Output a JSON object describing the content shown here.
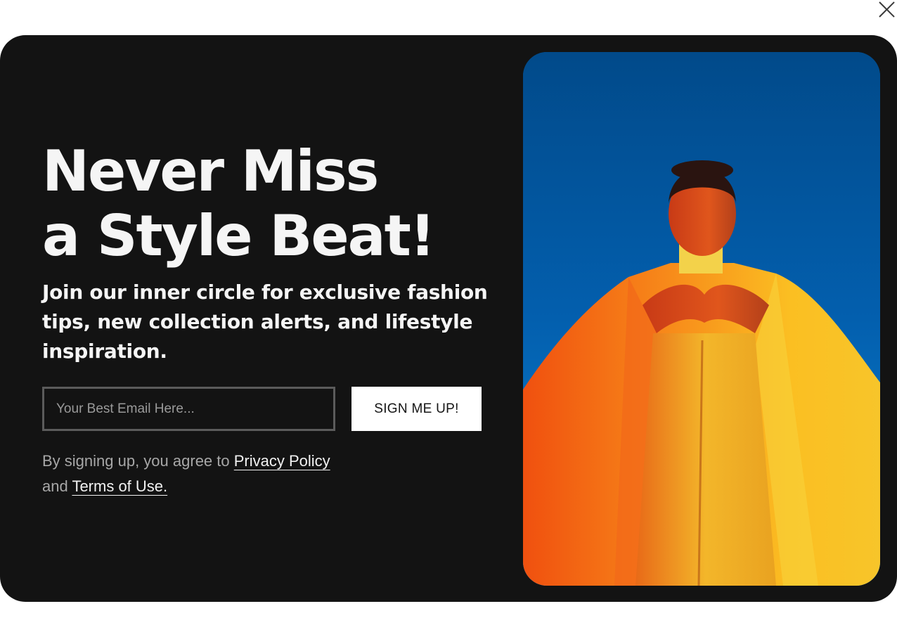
{
  "popup": {
    "headline_line1": "Never Miss",
    "headline_line2": "a Style Beat!",
    "subtext": "Join our inner circle for exclusive fashion tips, new collection alerts, and lifestyle inspiration.",
    "email_placeholder": "Your Best Email Here...",
    "signup_label": "SIGN ME UP!",
    "legal_prefix": "By signing up, you agree to",
    "privacy_link": "Privacy Policy",
    "legal_and": "and",
    "terms_link": "Terms of Use."
  },
  "icons": {
    "close": "close-icon"
  },
  "colors": {
    "modal_bg": "#131313",
    "text_primary": "#f5f5f5",
    "text_muted": "#a7a7a7",
    "button_bg": "#ffffff",
    "photo_sky": "#035fae",
    "photo_coat": "#f7a21b"
  }
}
